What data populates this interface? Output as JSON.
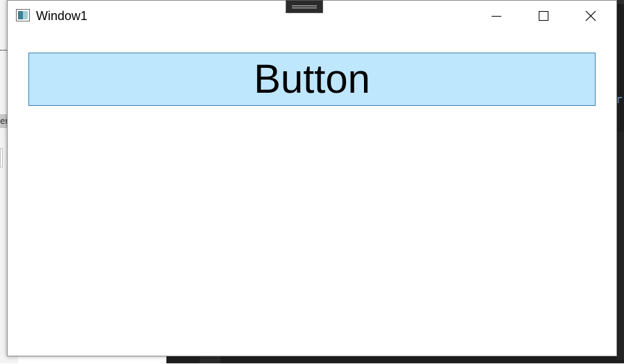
{
  "window": {
    "title": "Window1",
    "icon": "app-window-icon",
    "controls": {
      "minimize": "minimize-icon",
      "maximize": "maximize-icon",
      "close": "close-icon"
    }
  },
  "content": {
    "button_label": "Button"
  },
  "background": {
    "left_tab_text": "er",
    "right_code_text": "r"
  },
  "colors": {
    "button_fill": "#bee6fd",
    "button_border": "#3c7fb1",
    "window_bg": "#ffffff"
  }
}
